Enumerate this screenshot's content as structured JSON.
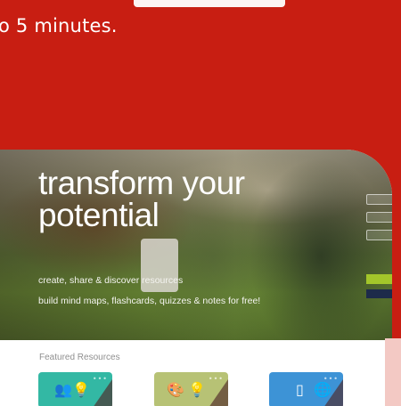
{
  "intro": {
    "text": "o 5 minutes."
  },
  "hero": {
    "title": "transform your potential",
    "subtitle_line1": "create, share & discover resources",
    "subtitle_line2": "build mind maps, flashcards, quizzes & notes for free!"
  },
  "featured": {
    "heading": "Featured Resources"
  },
  "colors": {
    "page_background": "#c81e12",
    "tile_teal": "#33b8a4",
    "tile_olive": "#b7c275",
    "tile_blue": "#3d93d6",
    "side_green": "#a3c62a"
  },
  "icons": {
    "tile_1": [
      "people-icon",
      "lightbulb-icon"
    ],
    "tile_2": [
      "palette-icon",
      "lightbulb-icon"
    ],
    "tile_3": [
      "phone-icon",
      "globe-icon"
    ]
  }
}
